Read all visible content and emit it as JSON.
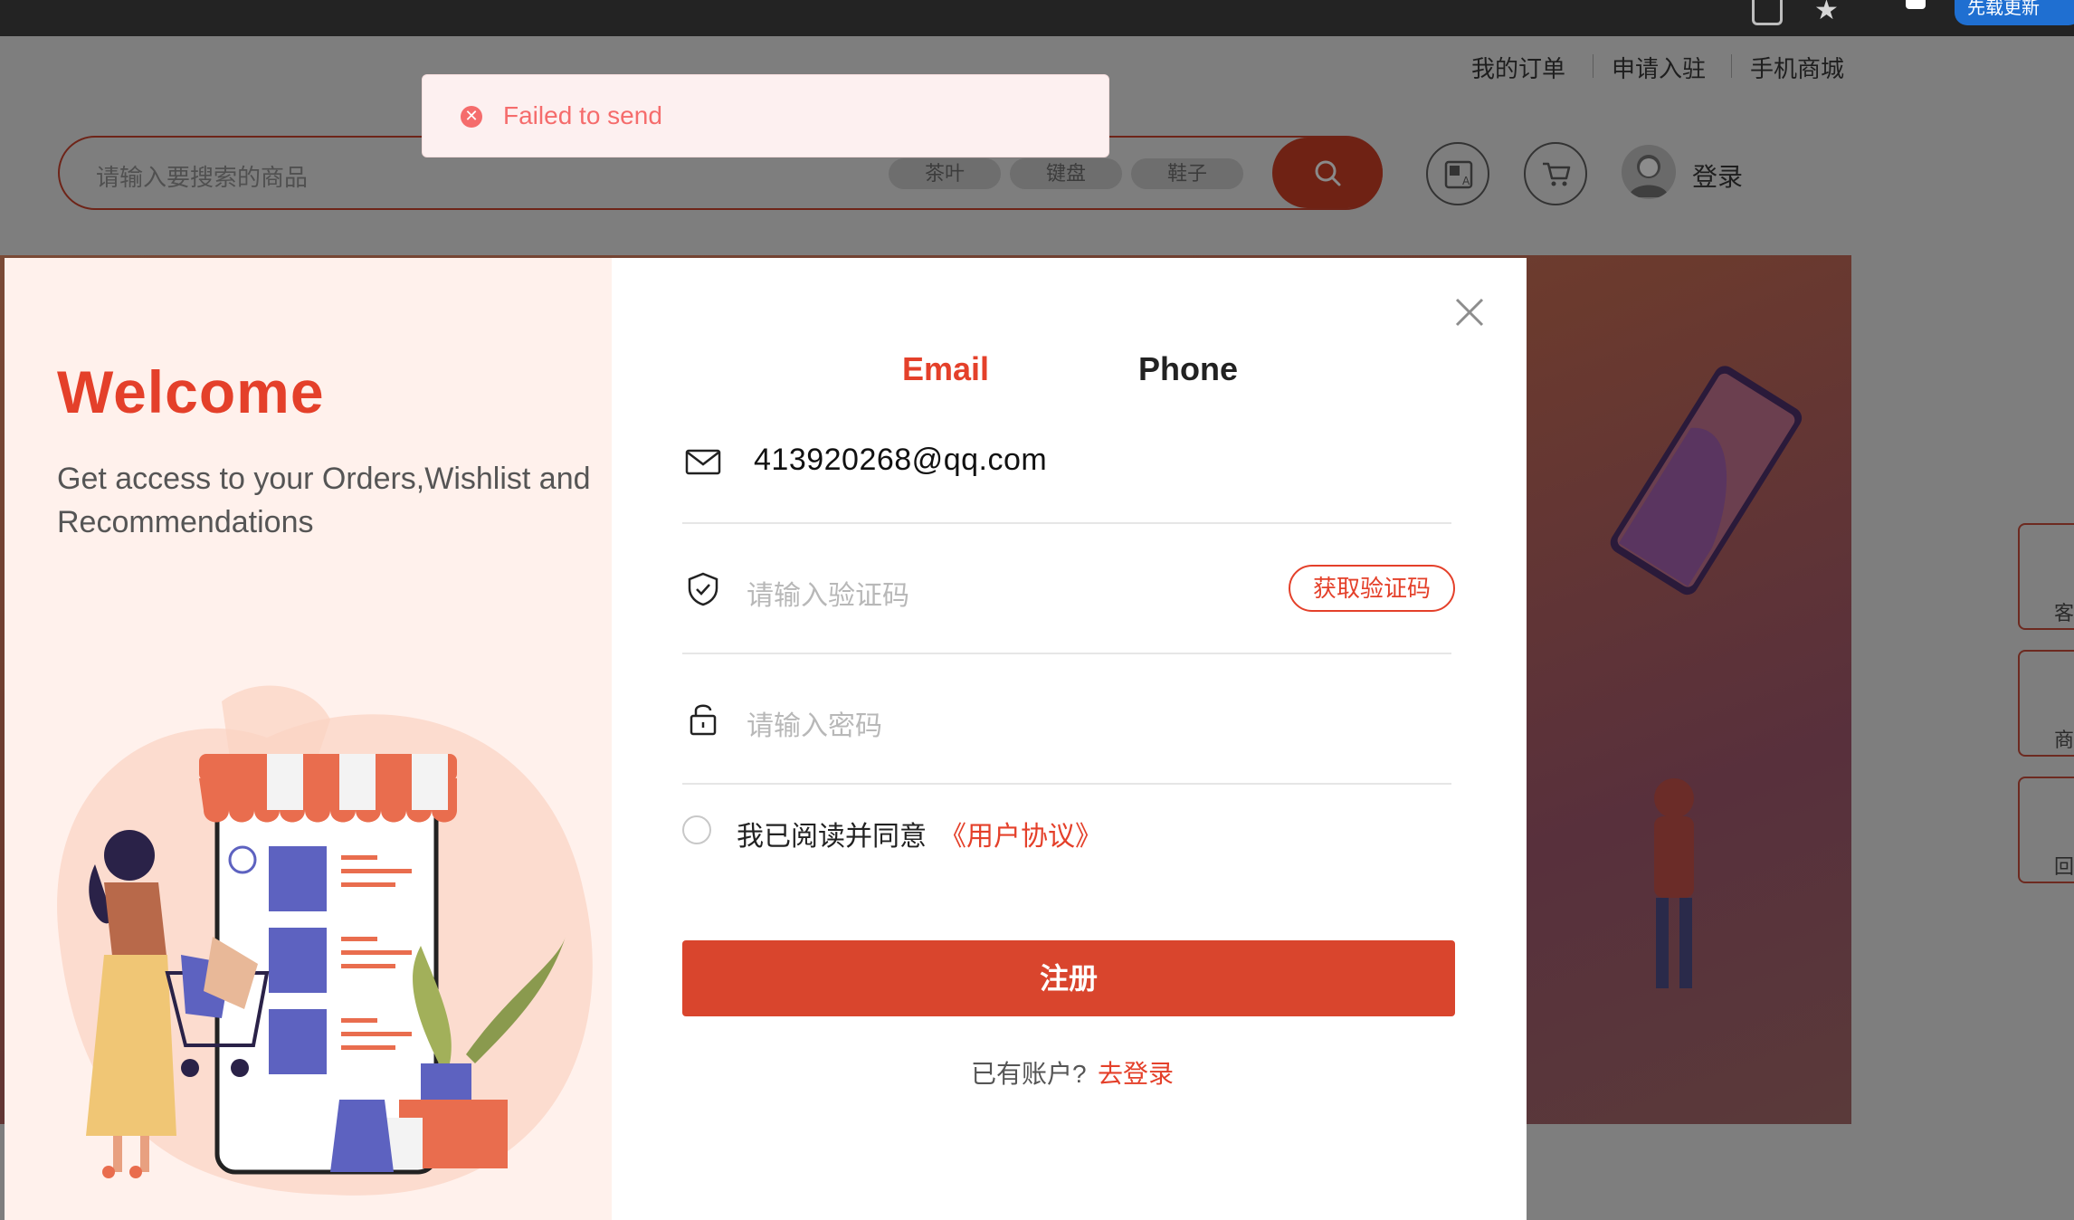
{
  "top_nav": {
    "links": [
      "我的订单",
      "申请入驻",
      "手机商城"
    ]
  },
  "search": {
    "placeholder": "请输入要搜索的商品",
    "hot_tags": [
      "茶叶",
      "键盘",
      "鞋子"
    ]
  },
  "header": {
    "login_label": "登录"
  },
  "side_tools": [
    "客",
    "商户",
    "回到"
  ],
  "browser": {
    "pill_text": "先载更新"
  },
  "toast": {
    "message": "Failed to send",
    "icon": "error-icon",
    "color": "#f56c6c"
  },
  "modal": {
    "welcome_title": "Welcome",
    "welcome_subtitle": "Get access to your Orders,Wishlist and Recommendations",
    "tabs": [
      {
        "label": "Email",
        "active": true
      },
      {
        "label": "Phone",
        "active": false
      }
    ],
    "email_value": "413920268@qq.com",
    "code_placeholder": "请输入验证码",
    "get_code_label": "获取验证码",
    "password_placeholder": "请输入密码",
    "agree_text": "我已阅读并同意",
    "agreement_link": "《用户协议》",
    "register_label": "注册",
    "have_account_text": "已有账户?",
    "go_login_label": "去登录",
    "accent_color": "#e4402a"
  }
}
